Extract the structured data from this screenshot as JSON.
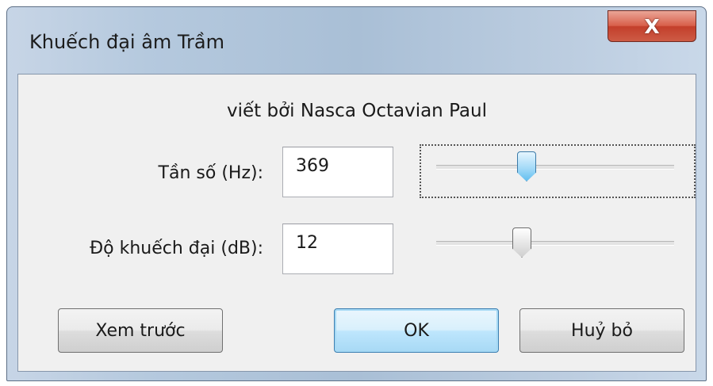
{
  "window": {
    "title": "Khuếch đại âm Trầm",
    "close_label": "X"
  },
  "author_text": "viết bởi Nasca Octavian Paul",
  "frequency": {
    "label": "Tần số (Hz):",
    "value": "369",
    "slider_position": 0.38
  },
  "gain": {
    "label": "Độ khuếch đại (dB):",
    "value": "12",
    "slider_position": 0.36
  },
  "buttons": {
    "preview": "Xem trước",
    "ok": "OK",
    "cancel": "Huỷ bỏ"
  }
}
